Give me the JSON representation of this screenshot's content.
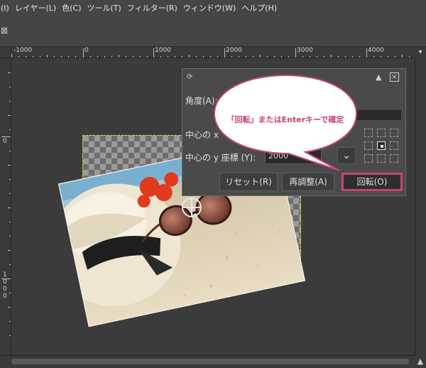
{
  "menubar": {
    "items": [
      "(I)",
      "レイヤー(L)",
      "色(C)",
      "ツール(T)",
      "フィルター(R)",
      "ウィンドウ(W)",
      "ヘルプ(H)"
    ]
  },
  "tab": {
    "close_glyph": "⊠"
  },
  "ruler": {
    "h_labels": [
      "-1000",
      "0",
      "1000",
      "2000",
      "3000",
      "4000"
    ],
    "v_labels": [
      "0",
      "1",
      "0",
      "0",
      "0"
    ]
  },
  "dialog": {
    "title": "回転",
    "angle_label": "角度(A):",
    "center_x_label": "中心の x",
    "center_y_label": "中心の y 座標 (Y):",
    "center_y_value": "2000",
    "buttons": {
      "reset": "リセット(R)",
      "readjust": "再調整(A)",
      "rotate": "回転(O)"
    }
  },
  "callout": {
    "text": "「回転」またはEnterキーで確定"
  },
  "colors": {
    "accent": "#c2447a",
    "selection": "#e8e000"
  }
}
